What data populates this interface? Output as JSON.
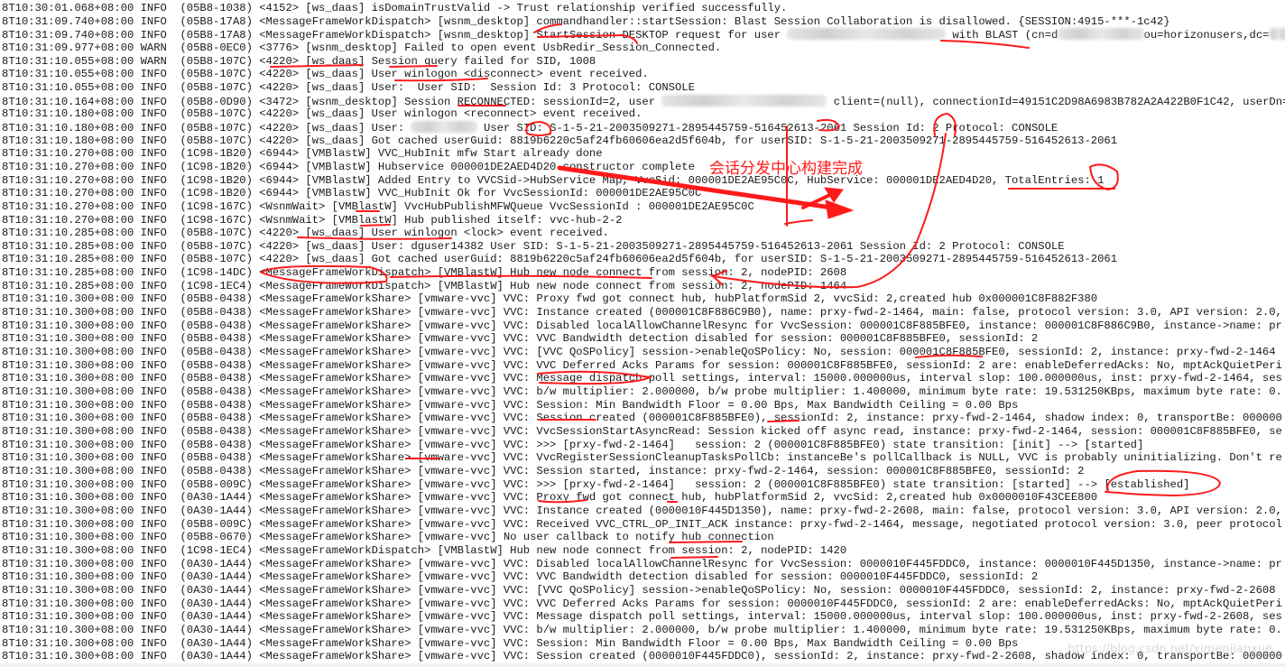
{
  "log": {
    "lines": [
      [
        {
          "t": "8T10:30:01.068+08:00 INFO  (05B8-1038) <4152> [ws_daas] isDomainTrustValid -> Trust relationship verified successfully."
        }
      ],
      [
        {
          "t": "8T10:31:09.740+08:00 INFO  (05B8-17A8) <MessageFrameWorkDispatch> [wsnm_desktop] commandhandler::startSession: Blast Session Collaboration is disallowed. {SESSION:4915-***-1c42}"
        }
      ],
      [
        {
          "t": "8T10:31:09.740+08:00 INFO  (05B8-17A8) <MessageFrameWorkDispatch> [wsnm_desktop] StartSession DESKTOP request for user "
        },
        {
          "blur": 24
        },
        {
          "t": " with BLAST (cn=d"
        },
        {
          "blur": 13
        },
        {
          "t": "ou=horizonusers,dc="
        },
        {
          "blur": 3
        }
      ],
      [
        {
          "t": "8T10:31:09.977+08:00 WARN  (05B8-0EC0) <3776> [wsnm_desktop] Failed to open event UsbRedir_Session_Connected."
        }
      ],
      [
        {
          "t": "8T10:31:10.055+08:00 WARN  (05B8-107C) <4220> [ws_daas] Session query failed for SID, 1008"
        }
      ],
      [
        {
          "t": "8T10:31:10.055+08:00 INFO  (05B8-107C) <4220> [ws_daas] User winlogon <disconnect> event received."
        }
      ],
      [
        {
          "t": "8T10:31:10.055+08:00 INFO  (05B8-107C) <4220> [ws_daas] User:  User SID:  Session Id: 3 Protocol: CONSOLE"
        }
      ],
      [
        {
          "t": "8T10:31:10.164+08:00 INFO  (05B8-0D90) <3472> [wsnm_desktop] Session RECONNECTED: sessionId=2, user "
        },
        {
          "blur": 25
        },
        {
          "t": " client=(null), connectionId=49151C2D98A6983B782A2A422B0F1C42, userDn=c"
        }
      ],
      [
        {
          "t": "8T10:31:10.180+08:00 INFO  (05B8-107C) <4220> [ws_daas] User winlogon <reconnect> event received."
        }
      ],
      [
        {
          "t": "8T10:31:10.180+08:00 INFO  (05B8-107C) <4220> [ws_daas] User: "
        },
        {
          "blur": 10
        },
        {
          "t": " User SID: S-1-5-21-2003509271-2895445759-516452613-2061 Session Id: 2 Protocol: CONSOLE"
        }
      ],
      [
        {
          "t": "8T10:31:10.180+08:00 INFO  (05B8-107C) <4220> [ws_daas] Got cached userGuid: 8819b6220c5af24fb60606ea2d5f604b, for userSID: S-1-5-21-2003509271-2895445759-516452613-2061"
        }
      ],
      [
        {
          "t": "8T10:31:10.270+08:00 INFO  (1C98-1B20) <6944> [VMBlastW] VVC_HubInit mfw Start already done"
        }
      ],
      [
        {
          "t": "8T10:31:10.270+08:00 INFO  (1C98-1B20) <6944> [VMBlastW] Hubservice 000001DE2AED4D20 constructor complete"
        }
      ],
      [
        {
          "t": "8T10:31:10.270+08:00 INFO  (1C98-1B20) <6944> [VMBlastW] Added Entry to VVCSid->HubService Map, VvcSid: 000001DE2AE95C0C, HubService: 000001DE2AED4D20, TotalEntries: 1"
        }
      ],
      [
        {
          "t": "8T10:31:10.270+08:00 INFO  (1C98-1B20) <6944> [VMBlastW] VVC_HubInit Ok for VvcSessionId: 000001DE2AE95C0C"
        }
      ],
      [
        {
          "t": "8T10:31:10.270+08:00 INFO  (1C98-167C) <WsnmWait> [VMBlastW] VvcHubPublishMFWQueue VvcSessionId : 000001DE2AE95C0C"
        }
      ],
      [
        {
          "t": "8T10:31:10.270+08:00 INFO  (1C98-167C) <WsnmWait> [VMBlastW] Hub published itself: vvc-hub-2-2"
        }
      ],
      [
        {
          "t": "8T10:31:10.285+08:00 INFO  (05B8-107C) <4220> [ws_daas] User winlogon <lock> event received."
        }
      ],
      [
        {
          "t": "8T10:31:10.285+08:00 INFO  (05B8-107C) <4220> [ws_daas] User: dguser14382 User SID: S-1-5-21-2003509271-2895445759-516452613-2061 Session Id: 2 Protocol: CONSOLE"
        }
      ],
      [
        {
          "t": "8T10:31:10.285+08:00 INFO  (05B8-107C) <4220> [ws_daas] Got cached userGuid: 8819b6220c5af24fb60606ea2d5f604b, for userSID: S-1-5-21-2003509271-2895445759-516452613-2061"
        }
      ],
      [
        {
          "t": "8T10:31:10.285+08:00 INFO  (1C98-14DC) <MessageFrameWorkDispatch> [VMBlastW] Hub new node connect from session: 2, nodePID: 2608"
        }
      ],
      [
        {
          "t": "8T10:31:10.285+08:00 INFO  (1C98-1EC4) <MessageFrameWorkDispatch> [VMBlastW] Hub new node connect from session: 2, nodePID: 1464"
        }
      ],
      [
        {
          "t": "8T10:31:10.300+08:00 INFO  (05B8-0438) <MessageFrameWorkShare> [vmware-vvc] VVC: Proxy fwd got connect hub, hubPlatformSid 2, vvcSid: 2,created hub 0x000001C8F882F380"
        }
      ],
      [
        {
          "t": "8T10:31:10.300+08:00 INFO  (05B8-0438) <MessageFrameWorkShare> [vmware-vvc] VVC: Instance created (000001C8F886C9B0), name: prxy-fwd-2-1464, main: false, protocol version: 3.0, API version: 2.0,"
        }
      ],
      [
        {
          "t": "8T10:31:10.300+08:00 INFO  (05B8-0438) <MessageFrameWorkShare> [vmware-vvc] VVC: Disabled localAllowChannelResync for VvcSession: 000001C8F885BFE0, instance: 000001C8F886C9B0, instance->name: pr"
        }
      ],
      [
        {
          "t": "8T10:31:10.300+08:00 INFO  (05B8-0438) <MessageFrameWorkShare> [vmware-vvc] VVC: VVC Bandwidth detection disabled for session: 000001C8F885BFE0, sessionId: 2"
        }
      ],
      [
        {
          "t": "8T10:31:10.300+08:00 INFO  (05B8-0438) <MessageFrameWorkShare> [vmware-vvc] VVC: [VVC QoSPolicy] session->enableQoSPolicy: No, session: 000001C8F885BFE0, sessionId: 2, instance: prxy-fwd-2-1464"
        }
      ],
      [
        {
          "t": "8T10:31:10.300+08:00 INFO  (05B8-0438) <MessageFrameWorkShare> [vmware-vvc] VVC: VVC Deferred Acks Params for session: 000001C8F885BFE0, sessionId: 2 are: enableDeferredAcks: No, mptAckQuietPeri"
        }
      ],
      [
        {
          "t": "8T10:31:10.300+08:00 INFO  (05B8-0438) <MessageFrameWorkShare> [vmware-vvc] VVC: Message dispatch poll settings, interval: 15000.000000us, interval slop: 100.000000us, inst: prxy-fwd-2-1464, ses"
        }
      ],
      [
        {
          "t": "8T10:31:10.300+08:00 INFO  (05B8-0438) <MessageFrameWorkShare> [vmware-vvc] VVC: b/w multiplier: 2.000000, b/w probe multiplier: 1.400000, minimum byte rate: 19.531250KBps, maximum byte rate: 0."
        }
      ],
      [
        {
          "t": "8T10:31:10.300+08:00 INFO  (05B8-0438) <MessageFrameWorkShare> [vmware-vvc] VVC: Session: Min Bandwidth Floor = 0.00 Bps, Max Bandwidth Ceiling = 0.00 Bps"
        }
      ],
      [
        {
          "t": "8T10:31:10.300+08:00 INFO  (05B8-0438) <MessageFrameWorkShare> [vmware-vvc] VVC: Session created (000001C8F885BFE0), sessionId: 2, instance: prxy-fwd-2-1464, shadow index: 0, transportBe: 000000"
        }
      ],
      [
        {
          "t": "8T10:31:10.300+08:00 INFO  (05B8-0438) <MessageFrameWorkShare> [vmware-vvc] VVC: VvcSessionStartAsyncRead: Session kicked off async read, instance: prxy-fwd-2-1464, session: 000001C8F885BFE0, se"
        }
      ],
      [
        {
          "t": "8T10:31:10.300+08:00 INFO  (05B8-0438) <MessageFrameWorkShare> [vmware-vvc] VVC: >>> [prxy-fwd-2-1464]   session: 2 (000001C8F885BFE0) state transition: [init] --> [started]"
        }
      ],
      [
        {
          "t": "8T10:31:10.300+08:00 INFO  (05B8-0438) <MessageFrameWorkShare> [vmware-vvc] VVC: VvcRegisterSessionCleanupTasksPollCb: instanceBe's pollCallback is NULL, VVC is probably uninitializing. Don't re"
        }
      ],
      [
        {
          "t": "8T10:31:10.300+08:00 INFO  (05B8-0438) <MessageFrameWorkShare> [vmware-vvc] VVC: Session started, instance: prxy-fwd-2-1464, session: 000001C8F885BFE0, sessionId: 2"
        }
      ],
      [
        {
          "t": "8T10:31:10.300+08:00 INFO  (05B8-009C) <MessageFrameWorkShare> [vmware-vvc] VVC: >>> [prxy-fwd-2-1464]   session: 2 (000001C8F885BFE0) state transition: [started] --> [established]"
        }
      ],
      [
        {
          "t": "8T10:31:10.300+08:00 INFO  (0A30-1A44) <MessageFrameWorkShare> [vmware-vvc] VVC: Proxy fwd got connect hub, hubPlatformSid 2, vvcSid: 2,created hub 0x0000010F43CEE800"
        }
      ],
      [
        {
          "t": "8T10:31:10.300+08:00 INFO  (0A30-1A44) <MessageFrameWorkShare> [vmware-vvc] VVC: Instance created (0000010F445D1350), name: prxy-fwd-2-2608, main: false, protocol version: 3.0, API version: 2.0,"
        }
      ],
      [
        {
          "t": "8T10:31:10.300+08:00 INFO  (05B8-009C) <MessageFrameWorkShare> [vmware-vvc] VVC: Received VVC_CTRL_OP_INIT_ACK instance: prxy-fwd-2-1464, message, negotiated protocol version: 3.0, peer protocol"
        }
      ],
      [
        {
          "t": "8T10:31:10.300+08:00 INFO  (05B8-0670) <MessageFrameWorkShare> [vmware-vvc] No user callback to notify hub connection"
        }
      ],
      [
        {
          "t": "8T10:31:10.300+08:00 INFO  (1C98-1EC4) <MessageFrameWorkDispatch> [VMBlastW] Hub new node connect from session: 2, nodePID: 1420"
        }
      ],
      [
        {
          "t": "8T10:31:10.300+08:00 INFO  (0A30-1A44) <MessageFrameWorkShare> [vmware-vvc] VVC: Disabled localAllowChannelResync for VvcSession: 0000010F445FDDC0, instance: 0000010F445D1350, instance->name: pr"
        }
      ],
      [
        {
          "t": "8T10:31:10.300+08:00 INFO  (0A30-1A44) <MessageFrameWorkShare> [vmware-vvc] VVC: VVC Bandwidth detection disabled for session: 0000010F445FDDC0, sessionId: 2"
        }
      ],
      [
        {
          "t": "8T10:31:10.300+08:00 INFO  (0A30-1A44) <MessageFrameWorkShare> [vmware-vvc] VVC: [VVC QoSPolicy] session->enableQoSPolicy: No, session: 0000010F445FDDC0, sessionId: 2, instance: prxy-fwd-2-2608"
        }
      ],
      [
        {
          "t": "8T10:31:10.300+08:00 INFO  (0A30-1A44) <MessageFrameWorkShare> [vmware-vvc] VVC: VVC Deferred Acks Params for session: 0000010F445FDDC0, sessionId: 2 are: enableDeferredAcks: No, mptAckQuietPeri"
        }
      ],
      [
        {
          "t": "8T10:31:10.300+08:00 INFO  (0A30-1A44) <MessageFrameWorkShare> [vmware-vvc] VVC: Message dispatch poll settings, interval: 15000.000000us, interval slop: 100.000000us, inst: prxy-fwd-2-2608, ses"
        }
      ],
      [
        {
          "t": "8T10:31:10.300+08:00 INFO  (0A30-1A44) <MessageFrameWorkShare> [vmware-vvc] VVC: b/w multiplier: 2.000000, b/w probe multiplier: 1.400000, minimum byte rate: 19.531250KBps, maximum byte rate: 0."
        }
      ],
      [
        {
          "t": "8T10:31:10.300+08:00 INFO  (0A30-1A44) <MessageFrameWorkShare> [vmware-vvc] VVC: Session: Min Bandwidth Floor = 0.00 Bps, Max Bandwidth Ceiling = 0.00 Bps"
        }
      ],
      [
        {
          "t": "8T10:31:10.300+08:00 INFO  (0A30-1A44) <MessageFrameWorkShare> [vmware-vvc] VVC: Session created (0000010F445FDDC0), sessionId: 2, instance: prxy-fwd-2-2608, shadow index: 0, transportBe: 000000"
        }
      ]
    ]
  },
  "annotation": {
    "note": "会话分发中心构建完成",
    "color": "#ff1a1a"
  },
  "watermark": "https://blog.csdn.net/ximenjianxue"
}
